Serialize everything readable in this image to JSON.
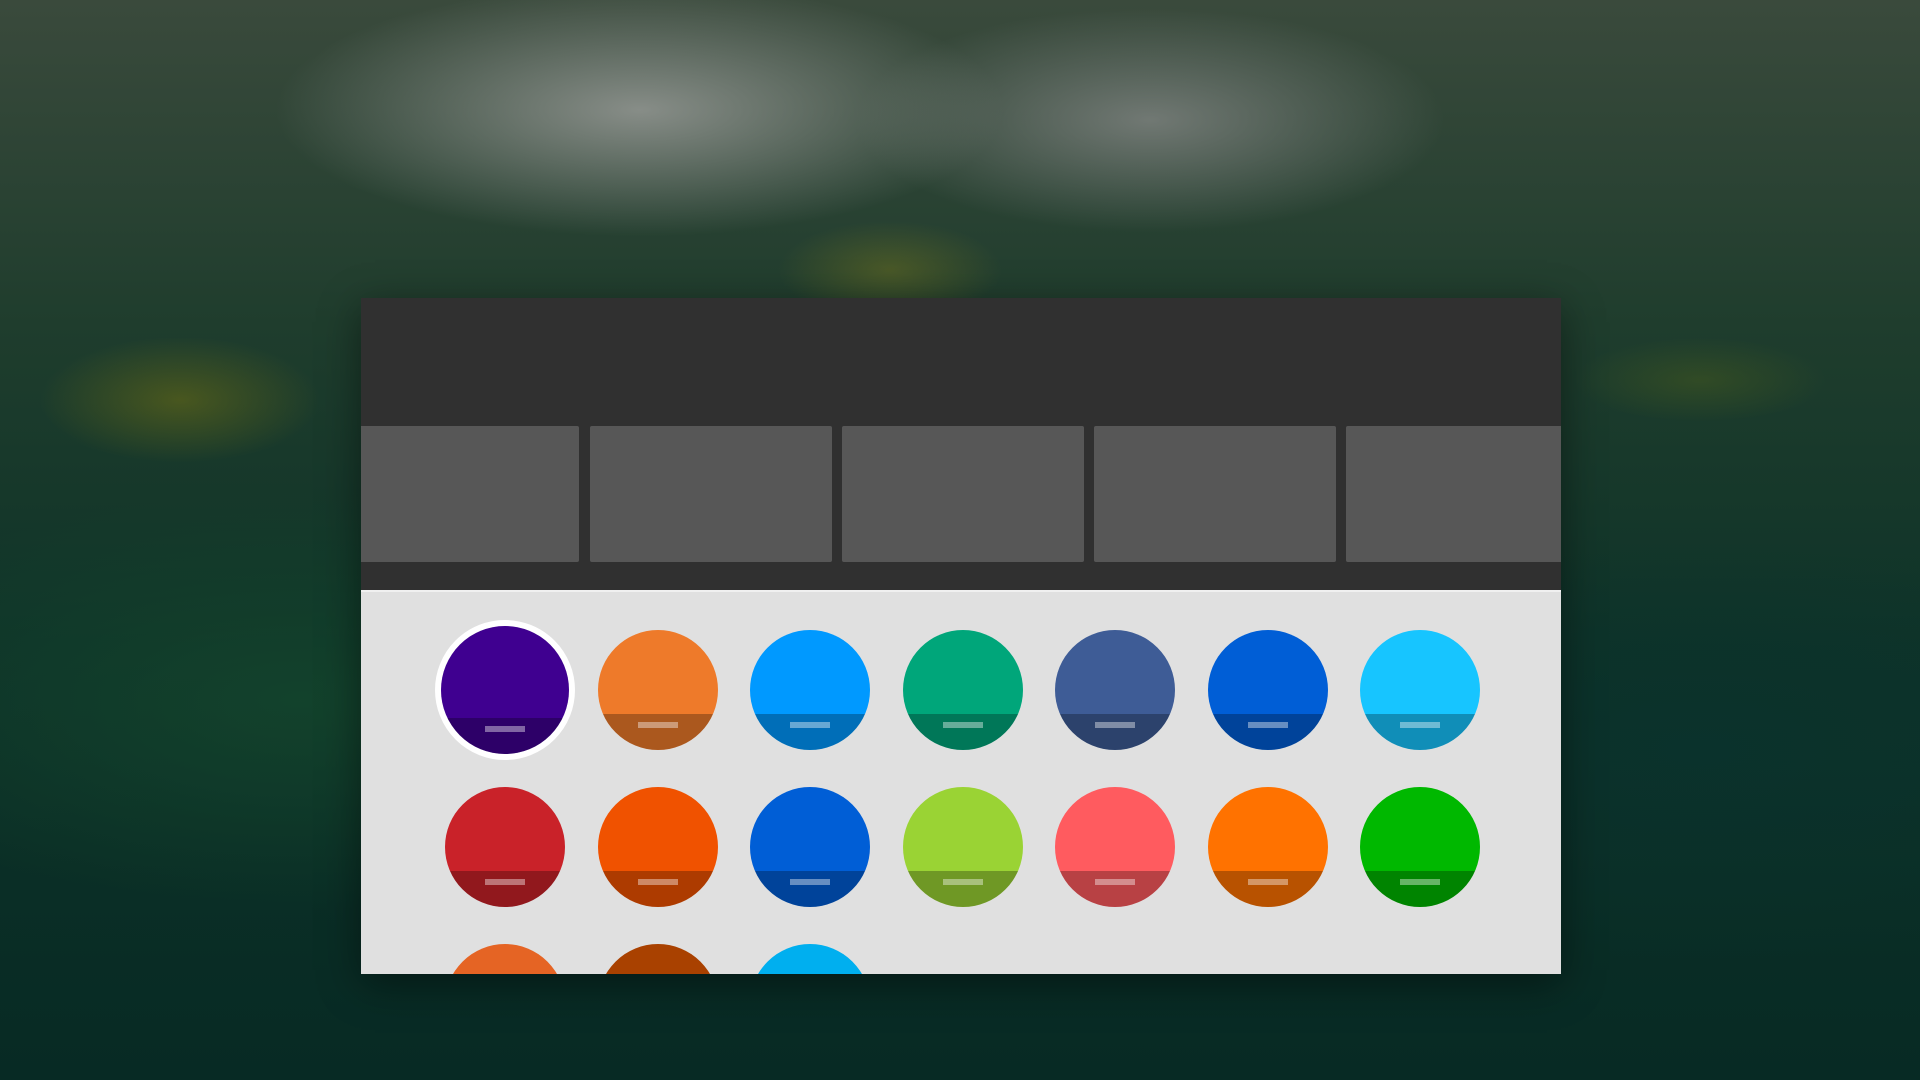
{
  "window": {
    "thumbnails": [
      "",
      "",
      "",
      "",
      ""
    ]
  },
  "accent_colors": {
    "selected": "#3f0090",
    "swatches": [
      {
        "color": "#3f0090",
        "selected": true
      },
      {
        "color": "#ee7a2a"
      },
      {
        "color": "#0099ff"
      },
      {
        "color": "#00a67a"
      },
      {
        "color": "#3e5c96"
      },
      {
        "color": "#005ed6"
      },
      {
        "color": "#17c5ff"
      },
      {
        "color": "#c92229"
      },
      {
        "color": "#f05200"
      },
      {
        "color": "#005ed6"
      },
      {
        "color": "#9ad334"
      },
      {
        "color": "#ff5b5f"
      },
      {
        "color": "#ff7200"
      },
      {
        "color": "#00b800"
      },
      {
        "color": "#e56424"
      },
      {
        "color": "#a94100"
      },
      {
        "color": "#00afef"
      }
    ]
  }
}
